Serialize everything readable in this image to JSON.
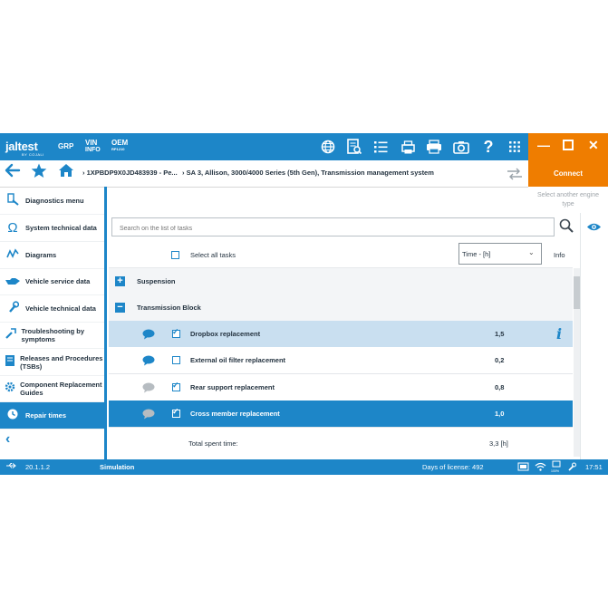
{
  "topbar": {
    "brand": "jaltest",
    "brand_sub": "BY COJALI",
    "grp_label": "GRP",
    "vin_label": "VIN",
    "vin_sub": "INFO",
    "oem_label": "OEM",
    "oem_sub": "RP1210",
    "icons": [
      "globe-icon",
      "document-search-icon",
      "list-icon",
      "printer-settings-icon",
      "printer-icon",
      "camera-icon",
      "help-icon",
      "apps-grid-icon"
    ],
    "window_controls": [
      "minimize-icon",
      "maximize-icon",
      "close-icon"
    ]
  },
  "navbar": {
    "breadcrumb_vin": "1XPBDP9X0JD483939 - Pe...",
    "breadcrumb_system": "SA 3, Allison, 3000/4000 Series (5th Gen), Transmission management system",
    "connect_label": "Connect",
    "select_engine": "Select another engine type"
  },
  "sidebar": {
    "items": [
      {
        "label": "Diagnostics menu",
        "icon": "diagnostics-icon"
      },
      {
        "label": "System technical data",
        "icon": "ohm-icon"
      },
      {
        "label": "Diagrams",
        "icon": "diagram-icon"
      },
      {
        "label": "Vehicle service data",
        "icon": "oil-can-icon"
      },
      {
        "label": "Vehicle technical data",
        "icon": "wrench-icon"
      },
      {
        "label": "Troubleshooting by symptoms",
        "icon": "troubleshoot-icon"
      },
      {
        "label": "Releases and Procedures (TSBs)",
        "icon": "book-icon"
      },
      {
        "label": "Component Replacement Guides",
        "icon": "gear-wrench-icon"
      },
      {
        "label": "Repair times",
        "icon": "clock-icon",
        "active": true
      }
    ]
  },
  "main": {
    "search_placeholder": "Search on the list of tasks",
    "select_all_label": "Select all tasks",
    "time_select": "Time - [h]",
    "info_header": "Info",
    "groups": [
      {
        "label": "Suspension",
        "expanded": false
      },
      {
        "label": "Transmission Block",
        "expanded": true
      }
    ],
    "tasks": [
      {
        "name": "Dropbox replacement",
        "time": "1,5",
        "checked": true,
        "bubble": "blue",
        "has_info": true
      },
      {
        "name": "External oil filter replacement",
        "time": "0,2",
        "checked": false,
        "bubble": "blue",
        "has_info": false
      },
      {
        "name": "Rear support replacement",
        "time": "0,8",
        "checked": true,
        "bubble": "grey",
        "has_info": false
      },
      {
        "name": "Cross member replacement",
        "time": "1,0",
        "checked": true,
        "bubble": "grey",
        "has_info": false
      }
    ],
    "total_label": "Total spent time:",
    "total_value": "3,3 [h]"
  },
  "statusbar": {
    "version": "20.1.1.2",
    "mode": "Simulation",
    "license": "Days of license: 492",
    "battery_pct": "100%",
    "time": "17:51"
  },
  "colors": {
    "primary": "#1d86c8",
    "accent": "#ef7d00",
    "selected_row": "#c9dff0"
  }
}
